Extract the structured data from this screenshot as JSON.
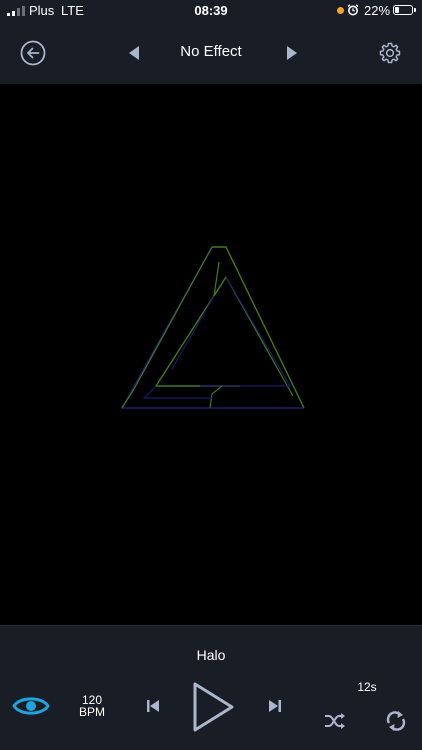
{
  "status_bar": {
    "carrier": "Plus",
    "network": "LTE",
    "time": "08:39",
    "battery_percent": "22%",
    "battery_level": 0.22,
    "indicator_dot_color": "#f5a623"
  },
  "top_nav": {
    "back_icon": "back-arrow-circle-icon",
    "prev_icon": "triangle-left-icon",
    "effect_name": "No Effect",
    "next_icon": "triangle-right-icon",
    "settings_icon": "gear-icon"
  },
  "visualizer": {
    "shape": "penrose-triangle",
    "colors": {
      "green": "#3f7a1e",
      "blue": "#1a1d66"
    }
  },
  "player": {
    "track_title": "Halo",
    "bpm_value": "120",
    "bpm_unit": "BPM",
    "duration": "12s",
    "accent_color": "#1fa4dd",
    "icons": {
      "eye": "eye-icon",
      "prev": "skip-previous-icon",
      "play": "play-icon",
      "next": "skip-next-icon",
      "shuffle": "shuffle-icon",
      "repeat": "repeat-icon"
    }
  }
}
